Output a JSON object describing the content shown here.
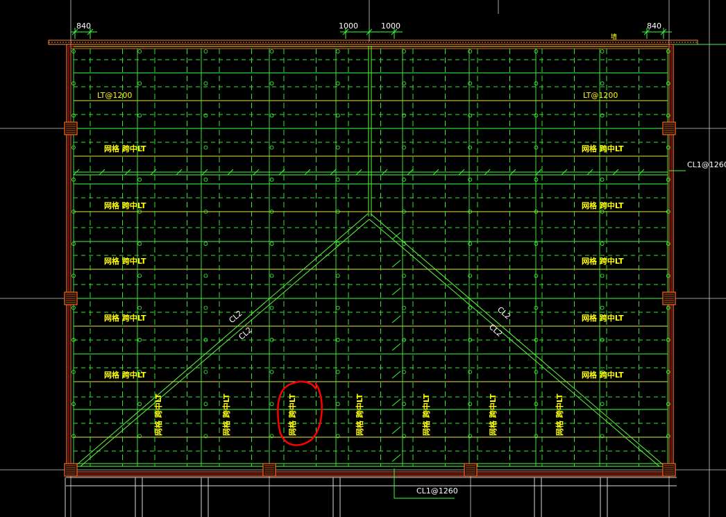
{
  "dimensions": {
    "top_left": "840",
    "top_right": "840",
    "center_left": "1000",
    "center_right": "1000",
    "top_right_extra": "墙"
  },
  "labels": {
    "lt1200_left": "LT@1200",
    "lt1200_right": "LT@1200",
    "cl1_right": "CL1@1260",
    "cl1_bottom": "CL1@1260",
    "cl2_a": "CL2",
    "cl2_b": "CL2",
    "cl2_c": "CL2",
    "cl2_d": "CL2",
    "grid_lt": "网格 跨中LT"
  },
  "colors": {
    "background": "#000000",
    "grid_green": "#3cff3c",
    "dash_green": "#2ee82e",
    "wall_orange": "#ff6a1a",
    "wall_red": "#ff2020",
    "text_yellow": "#ffff00",
    "text_white": "#ffffff",
    "annotation_red": "#ff0000"
  },
  "annotation": {
    "type": "red-circle",
    "target": "网格 跨中LT"
  }
}
